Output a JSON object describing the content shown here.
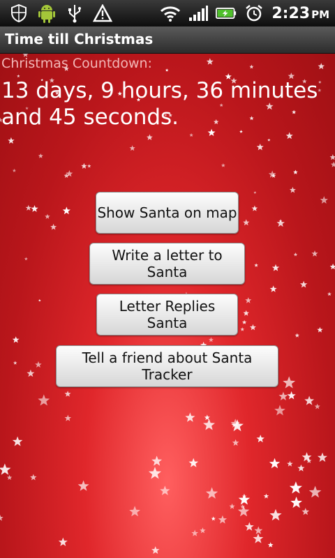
{
  "status_bar": {
    "icons_left": [
      "shield-icon",
      "android-icon",
      "usb-icon",
      "warning-icon"
    ],
    "icons_right": [
      "wifi-icon",
      "signal-icon",
      "battery-icon",
      "alarm-icon"
    ],
    "time": "2:23",
    "ampm": "PM"
  },
  "title_bar": {
    "title": "Time till Christmas"
  },
  "main": {
    "countdown_label": "Christmas Countdown:",
    "countdown_value": "13 days, 9 hours, 36 minutes and 45 seconds.",
    "buttons": [
      {
        "label": "Show Santa on map"
      },
      {
        "label": "Write a letter to Santa"
      },
      {
        "label": "Letter Replies Santa"
      },
      {
        "label": "Tell a friend about Santa Tracker"
      }
    ]
  },
  "colors": {
    "background": "#d51f24",
    "button": "#efefef",
    "title_bar": "#3d3d3d"
  }
}
